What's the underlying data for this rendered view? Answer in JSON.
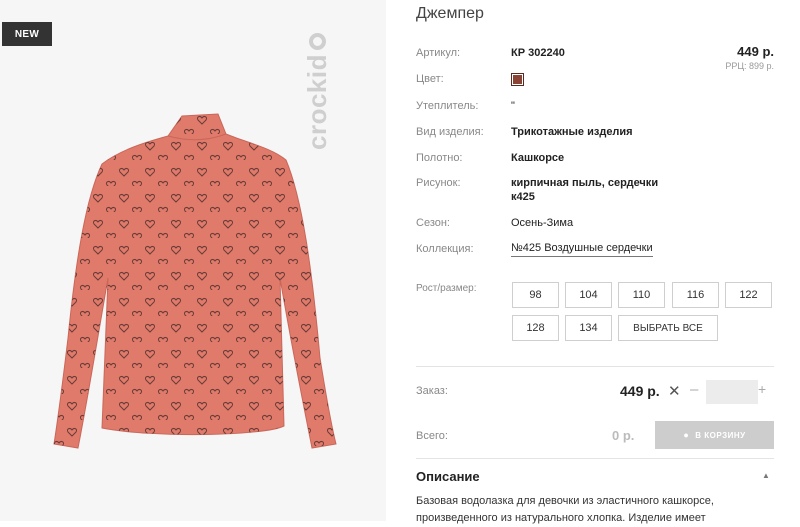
{
  "image": {
    "badge": "NEW",
    "logo": "crockid",
    "garment_color": "#e07a6a",
    "pattern_color": "#6a3c38"
  },
  "product": {
    "title": "Джемпер",
    "price": "449 р.",
    "rrp": "РРЦ: 899 р."
  },
  "specs": {
    "article_label": "Артикул:",
    "article_value": "КР 302240",
    "color_label": "Цвет:",
    "swatch_color": "#8a4334",
    "insulation_label": "Утеплитель:",
    "insulation_value": "\"",
    "type_label": "Вид изделия:",
    "type_value": "Трикотажные изделия",
    "fabric_label": "Полотно:",
    "fabric_value": "Кашкорсе",
    "print_label": "Рисунок:",
    "print_value_line1": "кирпичная пыль, сердечки",
    "print_value_line2": "к425",
    "season_label": "Сезон:",
    "season_value": "Осень-Зима",
    "collection_label": "Коллекция:",
    "collection_value": "№425 Воздушные сердечки"
  },
  "sizes": {
    "label": "Рост/размер:",
    "options": [
      "98",
      "104",
      "110",
      "116",
      "122",
      "128",
      "134"
    ],
    "select_all": "ВЫБРАТЬ ВСЕ"
  },
  "order": {
    "label": "Заказ:",
    "price": "449 р.",
    "times": "✕",
    "minus": "–",
    "plus": "+",
    "quantity": ""
  },
  "total": {
    "label": "Всего:",
    "value": "0 р.",
    "cart_button": "В КОРЗИНУ"
  },
  "description": {
    "heading": "Описание",
    "text": "Базовая водолазка для девочки из эластичного кашкорсе, произведенного из натурального хлопка. Изделие имеет"
  }
}
